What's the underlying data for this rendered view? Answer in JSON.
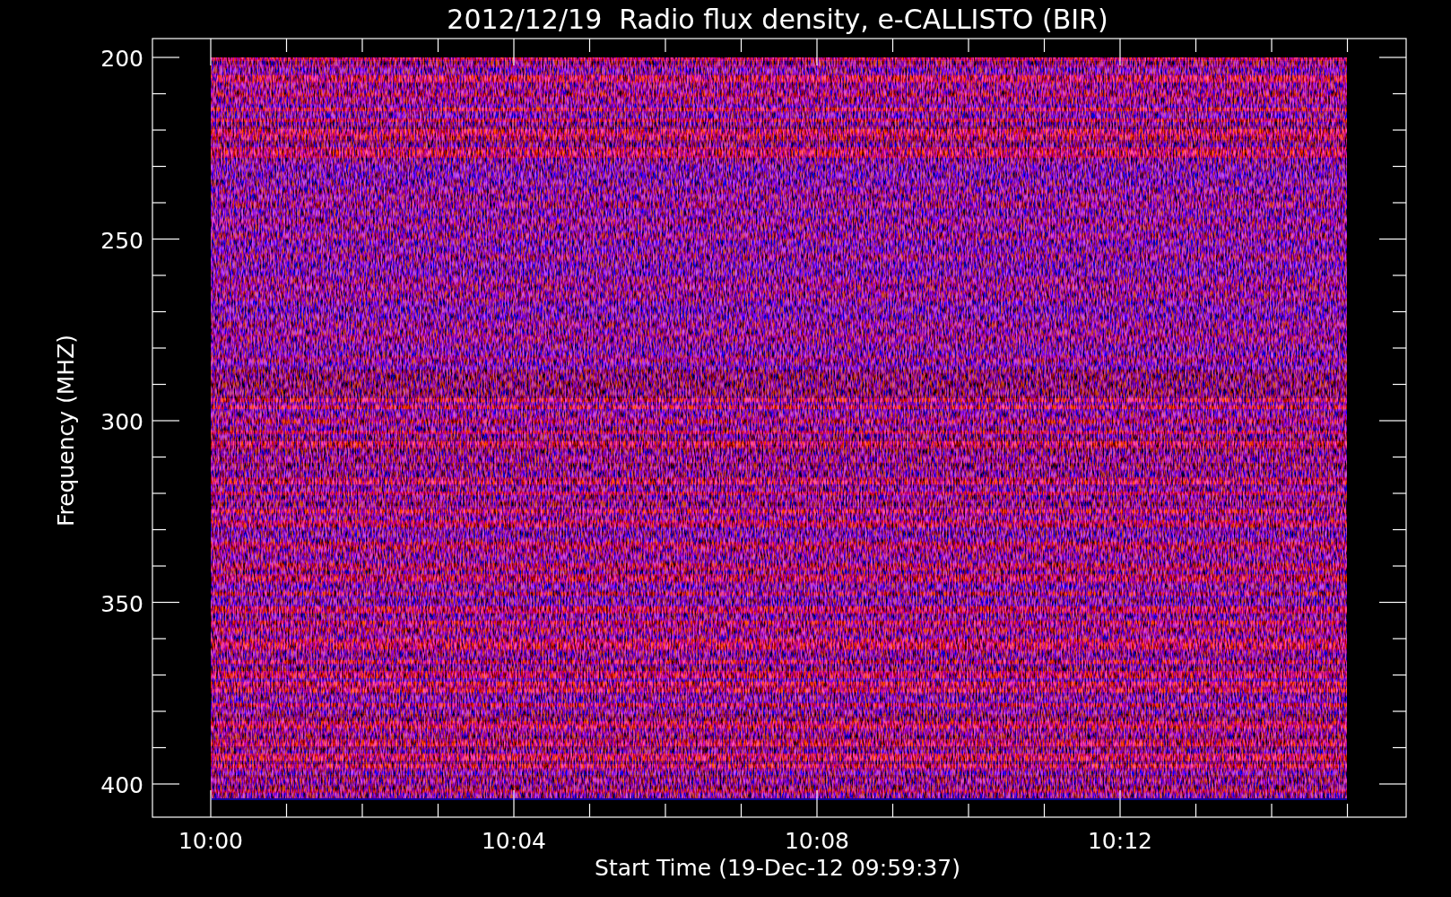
{
  "title": "2012/12/19  Radio flux density, e-CALLISTO (BIR)",
  "ylabel": "Frequency (MHZ)",
  "xlabel": "Start Time (19-Dec-12 09:59:37)",
  "yticks": [
    "200",
    "250",
    "300",
    "350",
    "400"
  ],
  "xticks": [
    "10:00",
    "10:04",
    "10:08",
    "10:12"
  ]
}
